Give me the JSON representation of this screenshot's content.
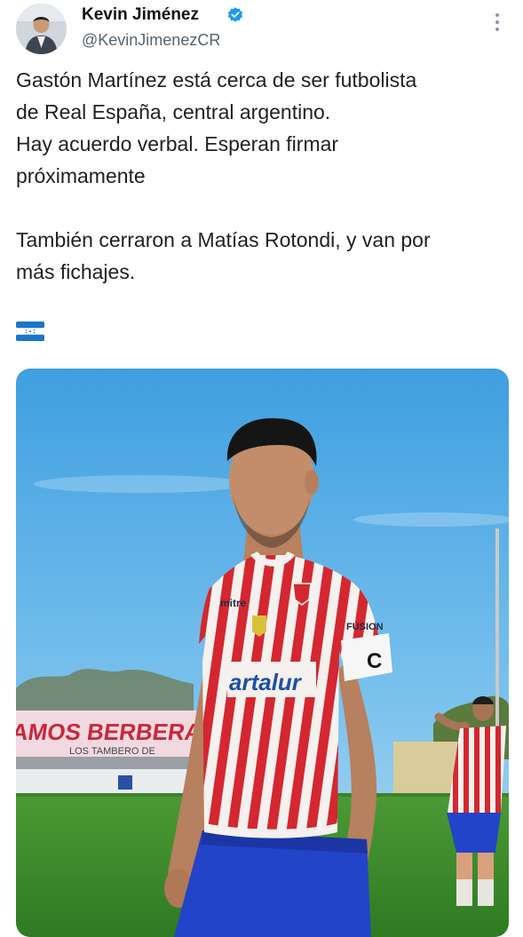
{
  "author": {
    "name": "Kevin Jiménez",
    "handle": "@KevinJimenezCR",
    "verified": true,
    "avatar_icon": "avatar-photo"
  },
  "tweet": {
    "paragraph_1": [
      "Gastón Martínez está cerca de ser futbolista",
      "de Real España, central argentino.",
      "Hay acuerdo verbal. Esperan firmar",
      "próximamente"
    ],
    "paragraph_2": [
      "También cerraron a Matías Rotondi, y van por",
      "más fichajes."
    ],
    "emoji": "honduras-flag"
  },
  "media": {
    "description_icon": "photo",
    "banner_text": "ESTAMOS BERBERA",
    "banner_subtext": "LOS TAMBERO DE",
    "sponsor": "artalur",
    "jersey_brand": "mitre",
    "sleeve_brand": "FUSION",
    "captain_letter": "C"
  },
  "colors": {
    "verified": "#1d9bf0",
    "sky": "#5bb1e6",
    "jersey_red": "#d4272f",
    "shorts_blue": "#2244c8",
    "grass": "#3f8a2e"
  }
}
